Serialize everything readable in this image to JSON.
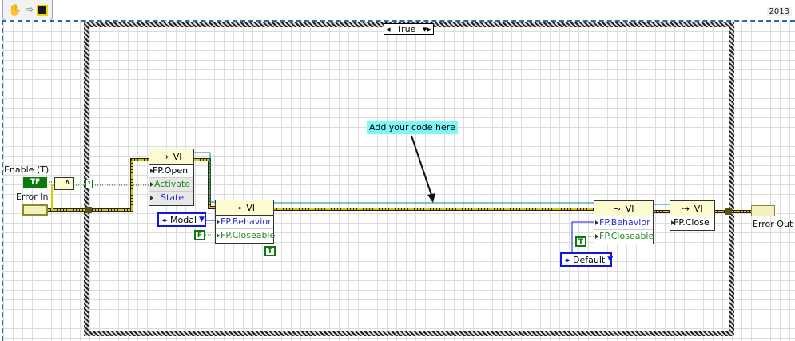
{
  "toolbar": {
    "icons": [
      "hand-icon",
      "arrow-icon",
      "vi-icon"
    ],
    "year": "2013"
  },
  "case": {
    "selector": "True"
  },
  "comment": "Add your code here",
  "controls": {
    "enable_label": "Enable (T)",
    "enable_glyph": "TF",
    "error_in_label": "Error In",
    "error_out_label": "Error Out"
  },
  "nodes": {
    "open": {
      "header": "VI",
      "method": "FP.Open",
      "inputs": [
        "Activate",
        "State"
      ]
    },
    "set1": {
      "header": "VI",
      "props": [
        "FP.Behavior",
        "FP.Closeable"
      ]
    },
    "set2": {
      "header": "VI",
      "props": [
        "FP.Behavior",
        "FP.Closeable"
      ]
    },
    "close": {
      "header": "VI",
      "method": "FP.Close"
    }
  },
  "constants": {
    "modal": "Modal",
    "default": "Default",
    "false": "F",
    "true1": "T",
    "true2": "T",
    "and": "∧",
    "coerce": "?"
  },
  "colors": {
    "error_wire": "#d8c800",
    "bool_wire": "#0a7a0a",
    "enum_wire": "#1414e0",
    "ref_wire": "#138080",
    "comment_bg": "#80f7f7"
  }
}
